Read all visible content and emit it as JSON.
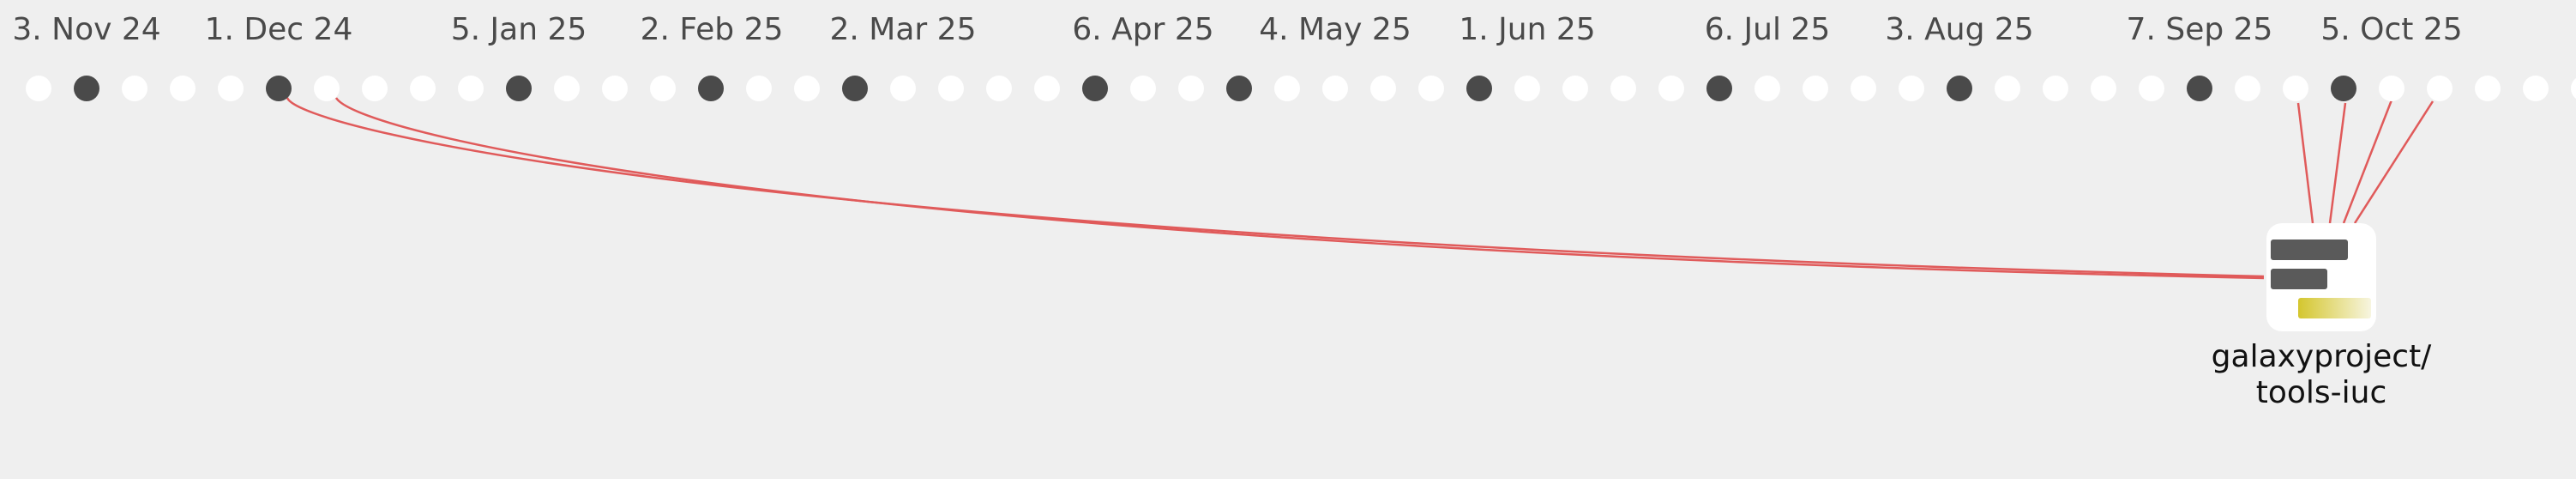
{
  "colors": {
    "background": "#efefef",
    "week_empty": "#ffffff",
    "week_active": "#4a4a4a",
    "connector": "#e05a5a",
    "repo_bar": "#5a5a5a",
    "repo_accent": "#d4c62e"
  },
  "timeline": {
    "date_labels": [
      "3. Nov 24",
      "1. Dec 24",
      "5. Jan 25",
      "2. Feb 25",
      "2. Mar 25",
      "6. Apr 25",
      "4. May 25",
      "1. Jun 25",
      "6. Jul 25",
      "3. Aug 25",
      "7. Sep 25",
      "5. Oct 25"
    ],
    "weeks": [
      0,
      1,
      0,
      0,
      0,
      1,
      0,
      0,
      0,
      0,
      1,
      0,
      0,
      0,
      1,
      0,
      0,
      1,
      0,
      0,
      0,
      0,
      1,
      0,
      0,
      1,
      0,
      0,
      0,
      0,
      1,
      0,
      0,
      0,
      0,
      1,
      0,
      0,
      0,
      0,
      1,
      0,
      0,
      0,
      0,
      1,
      0,
      0,
      1,
      0,
      0,
      0,
      0,
      0,
      0
    ]
  },
  "repository": {
    "name_line1": "galaxyproject/",
    "name_line2": "tools-iuc",
    "icon": "repository-icon"
  }
}
